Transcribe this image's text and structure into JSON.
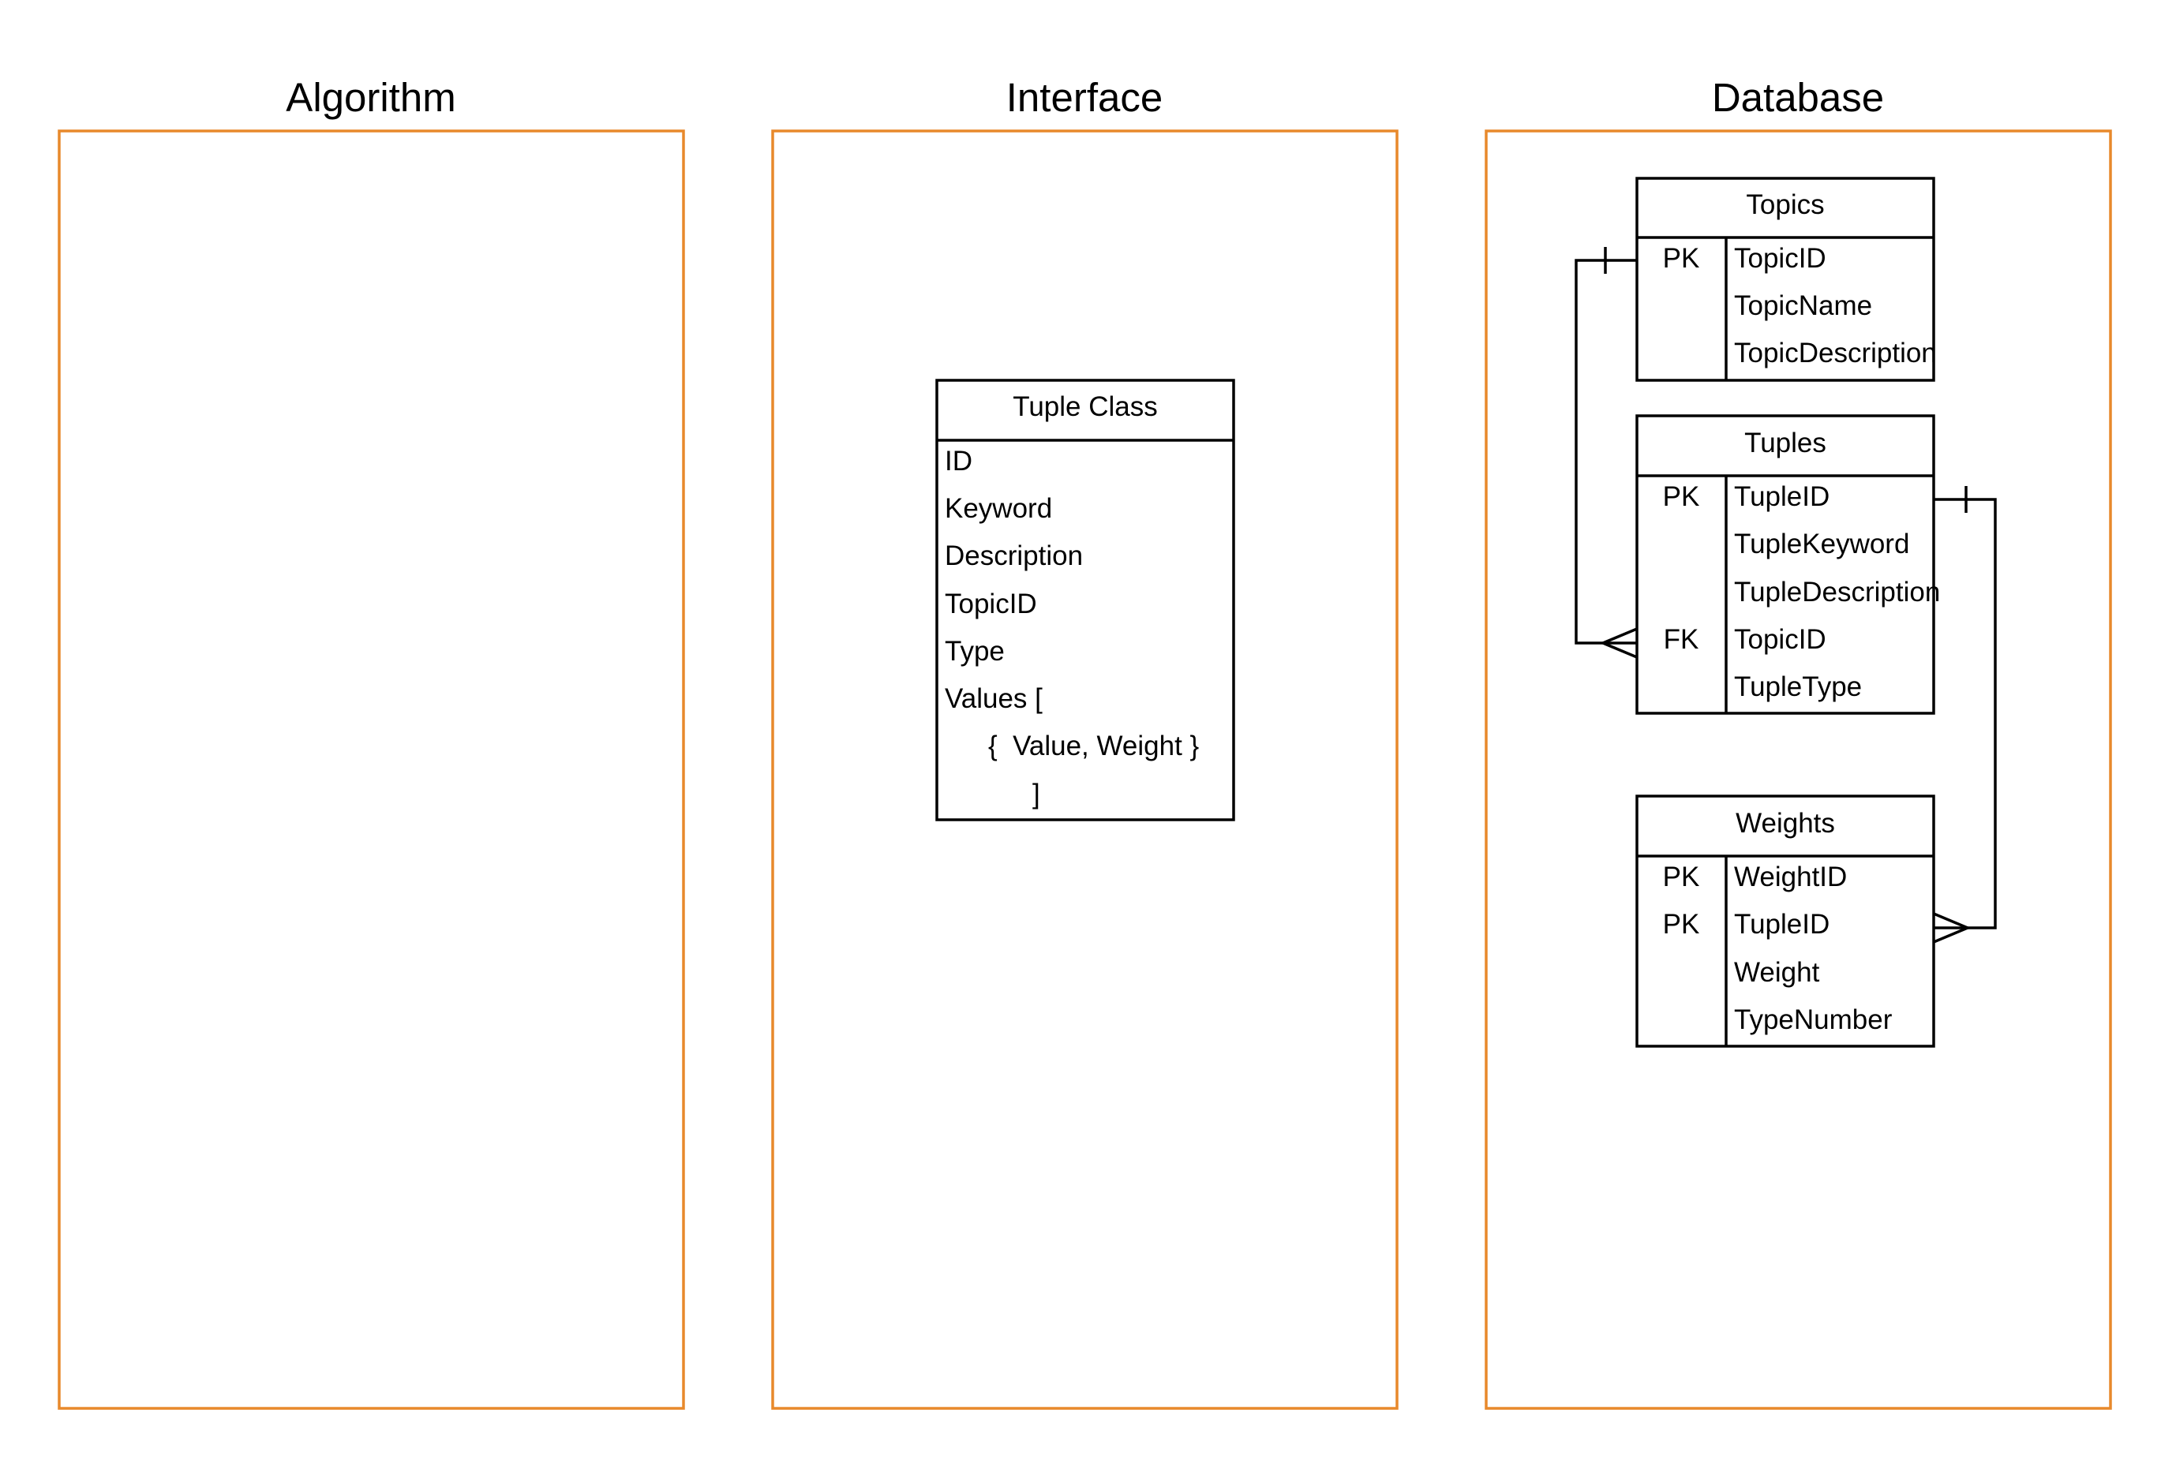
{
  "panels": [
    {
      "id": "algorithm",
      "title": "Algorithm"
    },
    {
      "id": "interface",
      "title": "Interface"
    },
    {
      "id": "database",
      "title": "Database"
    }
  ],
  "colors": {
    "panel_border": "#E8892B",
    "line": "#000000",
    "background": "#FFFFFF"
  },
  "interface": {
    "class_box": {
      "title": "Tuple Class",
      "fields": [
        "ID",
        "Keyword",
        "Description",
        "TopicID",
        "Type",
        "Values ["
      ],
      "values_entry": "{  Value, Weight }",
      "values_close": "]"
    }
  },
  "database": {
    "tables": [
      {
        "id": "topics",
        "name": "Topics",
        "rows": [
          {
            "key": "PK",
            "field": "TopicID"
          },
          {
            "key": "",
            "field": "TopicName"
          },
          {
            "key": "",
            "field": "TopicDescription"
          }
        ]
      },
      {
        "id": "tuples",
        "name": "Tuples",
        "rows": [
          {
            "key": "PK",
            "field": "TupleID"
          },
          {
            "key": "",
            "field": "TupleKeyword"
          },
          {
            "key": "",
            "field": "TupleDescription"
          },
          {
            "key": "FK",
            "field": "TopicID"
          },
          {
            "key": "",
            "field": "TupleType"
          }
        ]
      },
      {
        "id": "weights",
        "name": "Weights",
        "rows": [
          {
            "key": "PK",
            "field": "WeightID"
          },
          {
            "key": "PK",
            "field": "TupleID"
          },
          {
            "key": "",
            "field": "Weight"
          },
          {
            "key": "",
            "field": "TypeNumber"
          }
        ]
      }
    ],
    "relationships": [
      {
        "from": "Topics.TopicID",
        "to": "Tuples.TopicID",
        "type": "one-to-many"
      },
      {
        "from": "Tuples.TupleID",
        "to": "Weights.TupleID",
        "type": "one-to-many"
      }
    ]
  }
}
